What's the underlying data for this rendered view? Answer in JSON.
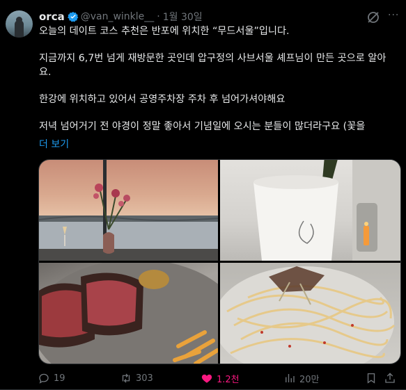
{
  "tweet": {
    "author": {
      "name": "orca",
      "handle": "@van_winkle__",
      "verified": true
    },
    "separator": "·",
    "date": "1월 30일",
    "text": {
      "p1": "오늘의 데이트 코스 추천은 반포에 위치한 “무드서울”입니다.",
      "p2": "지금까지 6,7번 넘게 재방문한 곳인데 압구정의 사브서울 셰프님이 만든 곳으로 알아요.",
      "p3": "한강에 위치하고 있어서 공영주차장 주차 후 넘어가셔야해요",
      "p4": "저녁 넘어거기 전 야경이 정말 좋아서 기념일에 오시는 분들이 많더라구요 (꽃을"
    },
    "show_more": "더 보기",
    "media": [
      {
        "icon": "sunset-river-view-photo"
      },
      {
        "icon": "wine-bucket-photo"
      },
      {
        "icon": "steak-and-fries-photo"
      },
      {
        "icon": "pasta-photo"
      }
    ],
    "actions": {
      "replies": "19",
      "retweets": "303",
      "likes": "1.2천",
      "views": "20만"
    },
    "colors": {
      "accent": "#1d9bf0",
      "like": "#f91880",
      "muted": "#71767b",
      "text": "#e7e9ea",
      "background": "#000000"
    }
  }
}
